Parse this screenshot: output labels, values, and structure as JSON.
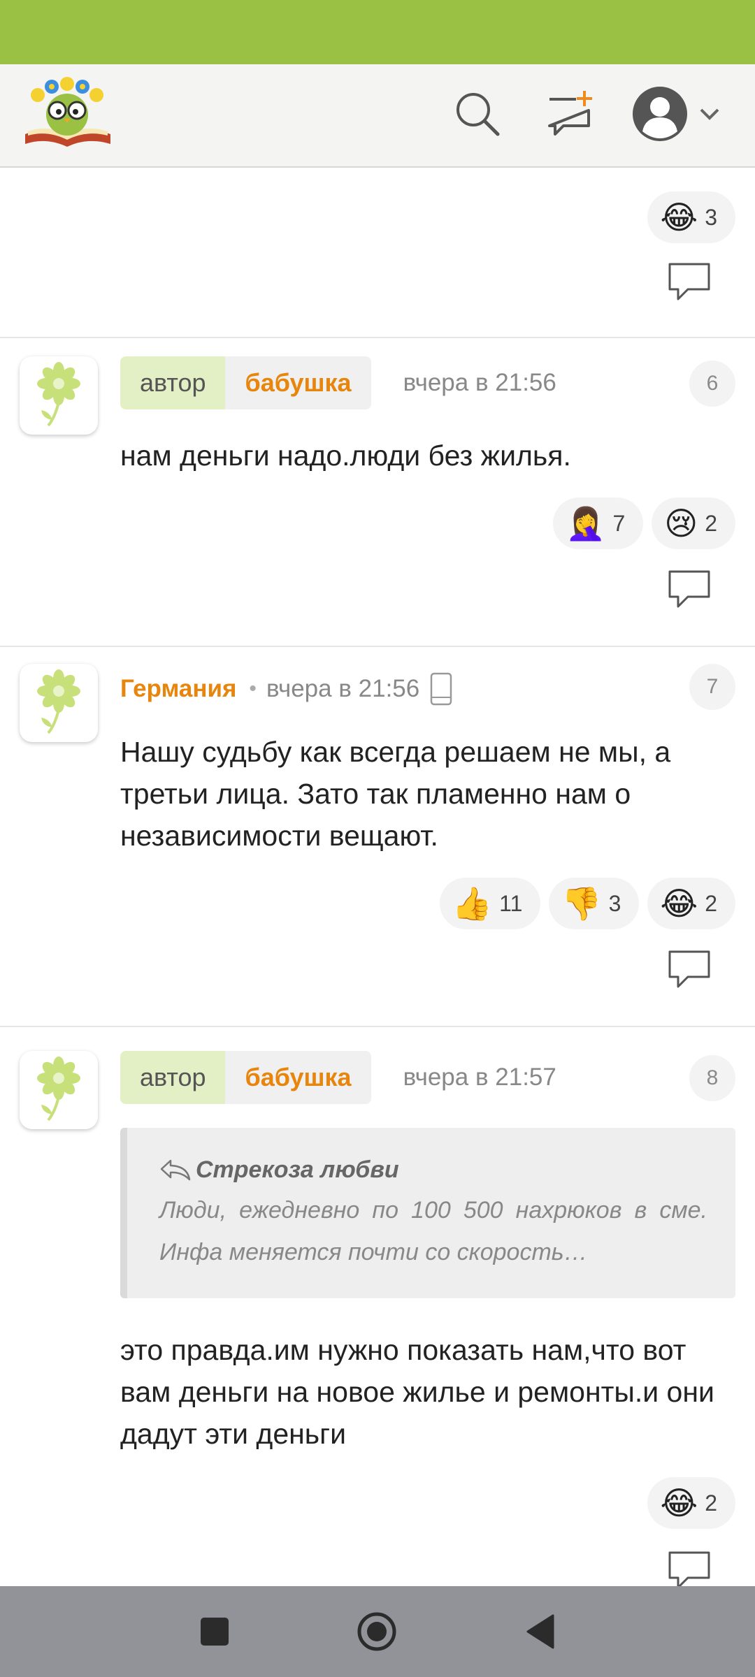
{
  "colors": {
    "status_bar": "#9bc144",
    "header_bg": "#f4f4f2",
    "author_badge_bg": "#e3efc5",
    "username": "#e8850c",
    "nav_bar": "#929299"
  },
  "header": {
    "logo": "owl-book-logo",
    "icons": [
      "search-icon",
      "new-message-icon",
      "profile-avatar-icon",
      "chevron-down-icon"
    ]
  },
  "top_reactions": [
    {
      "emoji": "😂",
      "count": "3"
    }
  ],
  "comments": [
    {
      "number": "6",
      "badge": "автор",
      "name": "бабушка",
      "time": "вчера в 21:56",
      "text": "нам деньги надо.люди без жилья.",
      "reactions": [
        {
          "emoji": "🤦‍♀️",
          "count": "7"
        },
        {
          "emoji": "😢",
          "count": "2"
        }
      ]
    },
    {
      "number": "7",
      "name": "Германия",
      "separator": "•",
      "time": "вчера в 21:56",
      "text": "Нашу судьбу как всегда решаем не мы, а третьи лица. Зато так пламенно нам о независимости вещают.",
      "reactions": [
        {
          "emoji": "👍",
          "count": "11"
        },
        {
          "emoji": "👎",
          "count": "3"
        },
        {
          "emoji": "😂",
          "count": "2"
        }
      ]
    },
    {
      "number": "8",
      "badge": "автор",
      "name": "бабушка",
      "time": "вчера в 21:57",
      "quote_author": "Стрекоза любви",
      "quote_text": "Люди, ежедневно по 100 500 нахрюков в сме. Инфа меняется почти со скорость…",
      "text": "это правда.им нужно показать нам,что вот вам деньги на новое жилье и ремонты.и они дадут эти деньги",
      "reactions": [
        {
          "emoji": "😂",
          "count": "2"
        }
      ]
    }
  ]
}
